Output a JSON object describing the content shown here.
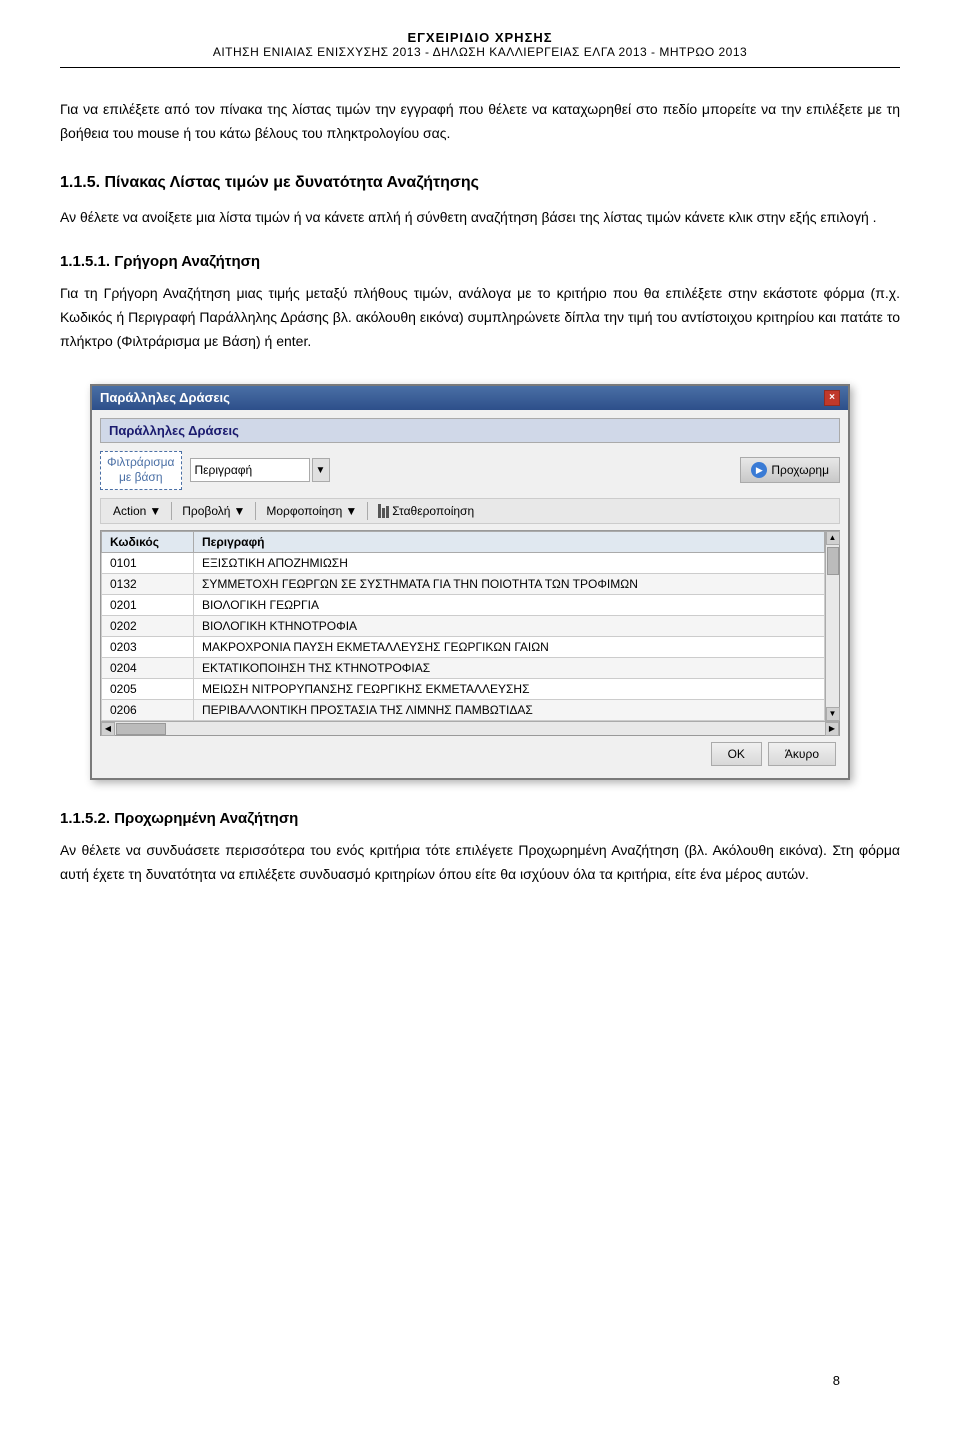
{
  "header": {
    "line1": "ΕΓΧΕΙΡΙΔΙΟ ΧΡΗΣΗΣ",
    "line2": "ΑΙΤΗΣΗ ΕΝΙΑΙΑΣ ΕΝΙΣΧΥΣΗΣ 2013 - ΔΗΛΩΣΗ ΚΑΛΛΙΕΡΓΕΙΑΣ ΕΛΓΑ 2013 - ΜΗΤΡΩΟ 2013"
  },
  "intro_text": "Για να επιλέξετε από τον πίνακα της λίστας τιμών την εγγραφή που θέλετε να καταχωρηθεί στο πεδίο μπορείτε να την επιλέξετε με τη βοήθεια του mouse ή του κάτω βέλους του πληκτρολογίου σας.",
  "section_1_1_5": {
    "heading": "1.1.5.  Πίνακας Λίστας τιμών  με δυνατότητα Αναζήτησης",
    "text": "Αν θέλετε να ανοίξετε μια λίστα τιμών ή να κάνετε απλή ή σύνθετη αναζήτηση βάσει της λίστας τιμών κάνετε κλικ στην εξής επιλογή ."
  },
  "section_1_1_5_1": {
    "heading": "1.1.5.1.  Γρήγορη Αναζήτηση",
    "text1": "Για τη Γρήγορη Αναζήτηση μιας τιμής μεταξύ πλήθους τιμών, ανάλογα με το κριτήριο που θα επιλέξετε στην εκάστοτε φόρμα (π.χ. Κωδικός ή Περιγραφή Παράλληλης Δράσης βλ. ακόλουθη εικόνα) συμπληρώνετε δίπλα την τιμή του αντίστοιχου κριτηρίου και πατάτε το πλήκτρο (Φιλτράρισμα με Βάση) ή enter."
  },
  "dialog": {
    "title": "Παράλληλες Δράσεις",
    "close_btn": "×",
    "section_header": "Παράλληλες Δράσεις",
    "filter_label_line1": "Φιλτράρισμα",
    "filter_label_line2": "με βάση",
    "filter_input_value": "Περιγραφή",
    "proceed_btn_label": "Προχωρημ",
    "menu": {
      "action_label": "Action",
      "action_arrow": "▼",
      "view_label": "Προβολή",
      "view_arrow": "▼",
      "format_label": "Μορφοποίηση",
      "format_arrow": "▼",
      "stabilize_label": "Σταθεροποίηση"
    },
    "table": {
      "columns": [
        "Κωδικός",
        "Περιγραφή"
      ],
      "rows": [
        {
          "code": "0101",
          "description": "ΕΞΙΣΩΤΙΚΗ ΑΠΟΖΗΜΙΩΣΗ"
        },
        {
          "code": "0132",
          "description": "ΣΥΜΜΕΤΟΧΗ ΓΕΩΡΓΩΝ ΣΕ ΣΥΣΤΗΜΑΤΑ ΓΙΑ ΤΗΝ ΠΟΙΟΤΗΤΑ ΤΩΝ ΤΡΟΦΙΜΩΝ"
        },
        {
          "code": "0201",
          "description": "ΒΙΟΛΟΓΙΚΗ ΓΕΩΡΓΙΑ"
        },
        {
          "code": "0202",
          "description": "ΒΙΟΛΟΓΙΚΗ ΚΤΗΝΟΤΡΟΦΙΑ"
        },
        {
          "code": "0203",
          "description": "ΜΑΚΡΟΧΡΟΝΙΑ ΠΑΥΣΗ ΕΚΜΕΤΑΛΛΕΥΣΗΣ ΓΕΩΡΓΙΚΩΝ ΓΑΙΩΝ"
        },
        {
          "code": "0204",
          "description": "ΕΚΤΑΤΙΚΟΠΟΙΗΣΗ ΤΗΣ ΚΤΗΝΟΤΡΟΦΙΑΣ"
        },
        {
          "code": "0205",
          "description": "ΜΕΙΩΣΗ ΝΙΤΡΟΡΥΠΑΝΣΗΣ ΓΕΩΡΓΙΚΗΣ ΕΚΜΕΤΑΛΛΕΥΣΗΣ"
        },
        {
          "code": "0206",
          "description": "ΠΕΡΙΒΑΛΛΟΝΤΙΚΗ ΠΡΟΣΤΑΣΙΑ ΤΗΣ ΛΙΜΝΗΣ ΠΑΜΒΩΤΙΔΑΣ"
        }
      ]
    },
    "ok_btn": "ΟΚ",
    "cancel_btn": "Άκυρο"
  },
  "section_1_1_5_2": {
    "heading": "1.1.5.2.  Προχωρημένη Αναζήτηση",
    "text": "Αν θέλετε να συνδυάσετε περισσότερα του ενός κριτήρια τότε επιλέγετε Προχωρημένη Αναζήτηση (βλ. Ακόλουθη εικόνα). Στη φόρμα αυτή έχετε τη δυνατότητα να επιλέξετε συνδυασμό κριτηρίων όπου είτε θα ισχύουν όλα τα κριτήρια, είτε ένα μέρος αυτών."
  },
  "page_number": "8"
}
